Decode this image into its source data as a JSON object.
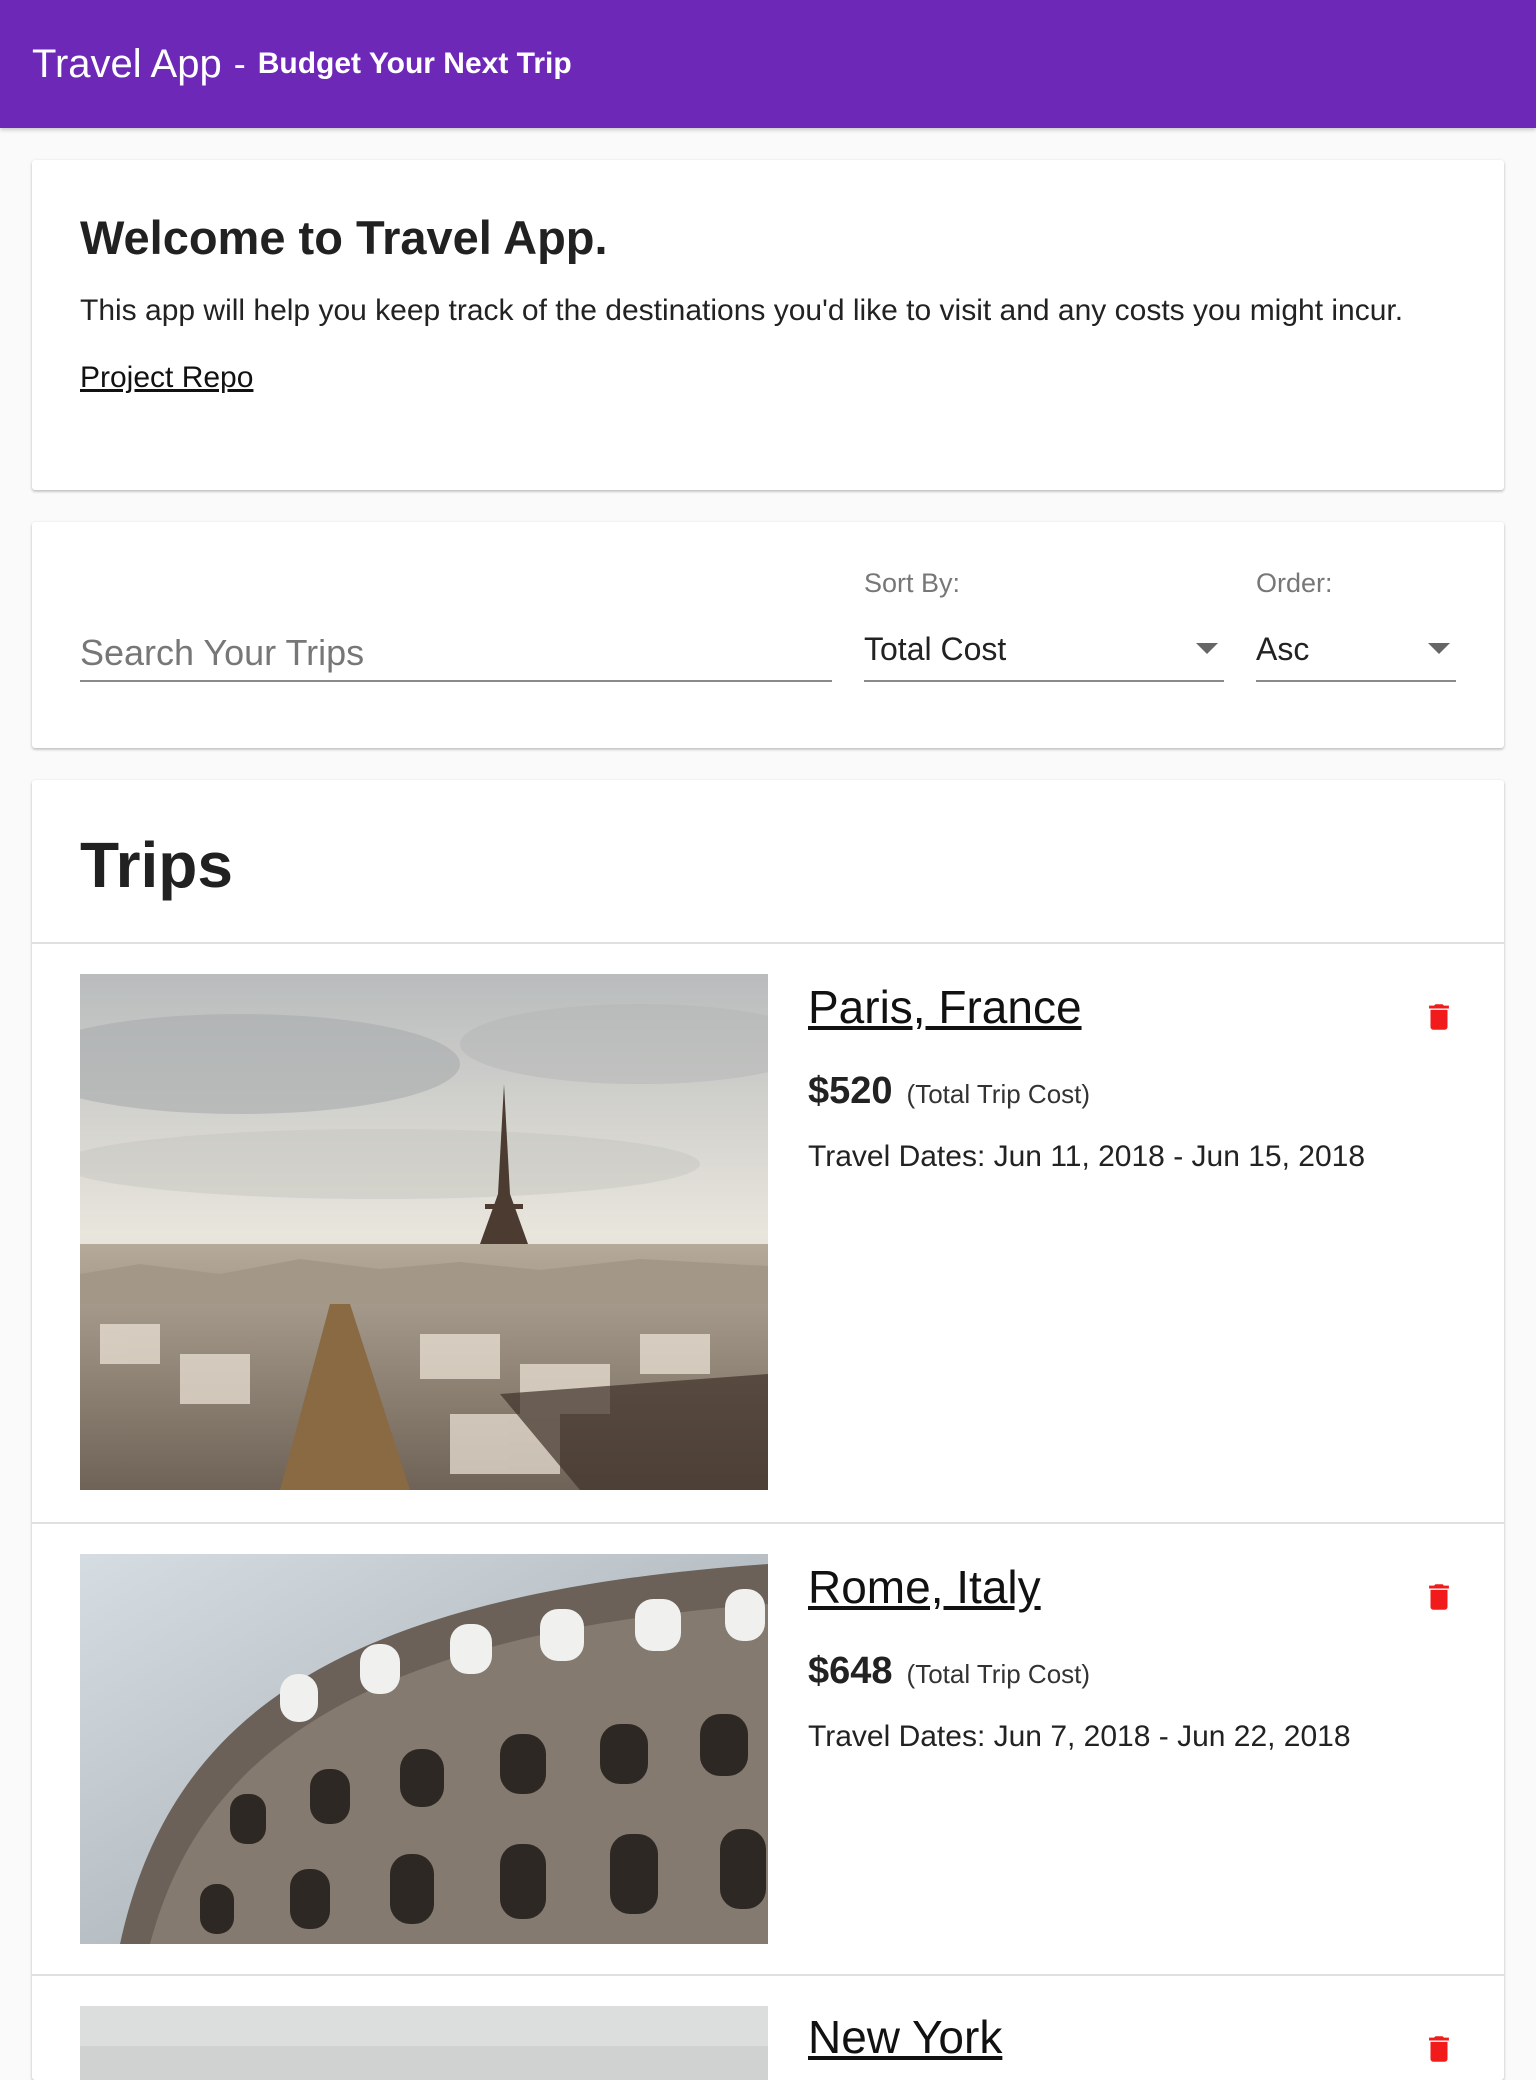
{
  "header": {
    "title": "Travel App",
    "separator": "-",
    "subtitle": "Budget Your Next Trip",
    "color": "#6d28b8"
  },
  "welcome": {
    "heading": "Welcome to Travel App.",
    "description": "This app will help you keep track of the destinations you'd like to visit and any costs you might incur.",
    "link_label": "Project Repo"
  },
  "filters": {
    "search_placeholder": "Search Your Trips",
    "sort_label": "Sort By:",
    "sort_value": "Total Cost",
    "order_label": "Order:",
    "order_value": "Asc"
  },
  "trips": {
    "heading": "Trips",
    "cost_note": "(Total Trip Cost)",
    "delete_icon": "trash-icon",
    "delete_color": "#f21b1b",
    "items": [
      {
        "name": "Paris, France",
        "cost": "$520",
        "dates": "Travel Dates: Jun 11, 2018 - Jun 15, 2018"
      },
      {
        "name": "Rome, Italy",
        "cost": "$648",
        "dates": "Travel Dates: Jun 7, 2018 - Jun 22, 2018"
      },
      {
        "name": "New York"
      }
    ]
  }
}
